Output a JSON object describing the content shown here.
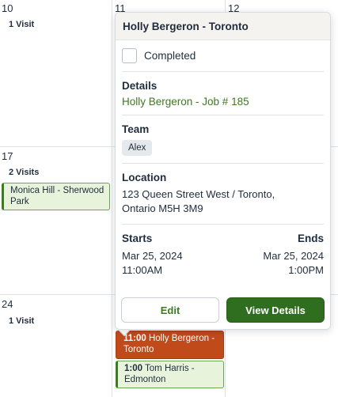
{
  "calendar": {
    "days": {
      "d10": "10",
      "d11": "11",
      "d12": "12",
      "d17": "17",
      "d24": "24"
    },
    "visits": {
      "w1": "1 Visit",
      "w2": "2 Visits",
      "w3": "1 Visit"
    },
    "events": {
      "monica": "Monica Hill - Sherwood Park",
      "holly_time": "11:00",
      "holly_name": "Holly Bergeron - Toronto",
      "tom_time": "1:00",
      "tom_name": "Tom Harris - Edmonton"
    }
  },
  "popover": {
    "title": "Holly Bergeron - Toronto",
    "completed_label": "Completed",
    "details_label": "Details",
    "details_link": "Holly Bergeron - Job # 185",
    "team_label": "Team",
    "team_member": "Alex",
    "location_label": "Location",
    "address_line1": "123 Queen Street West / Toronto,",
    "address_line2": "Ontario M5H 3M9",
    "starts_label": "Starts",
    "ends_label": "Ends",
    "start_date": "Mar 25, 2024",
    "start_time": "11:00AM",
    "end_date": "Mar 25, 2024",
    "end_time": "1:00PM",
    "edit_label": "Edit",
    "view_label": "View Details"
  },
  "colors": {
    "accent_green": "#3d7a22",
    "button_green": "#2f6e1e",
    "event_orange": "#c14a1b",
    "event_green_bg": "#e8f3dc"
  }
}
